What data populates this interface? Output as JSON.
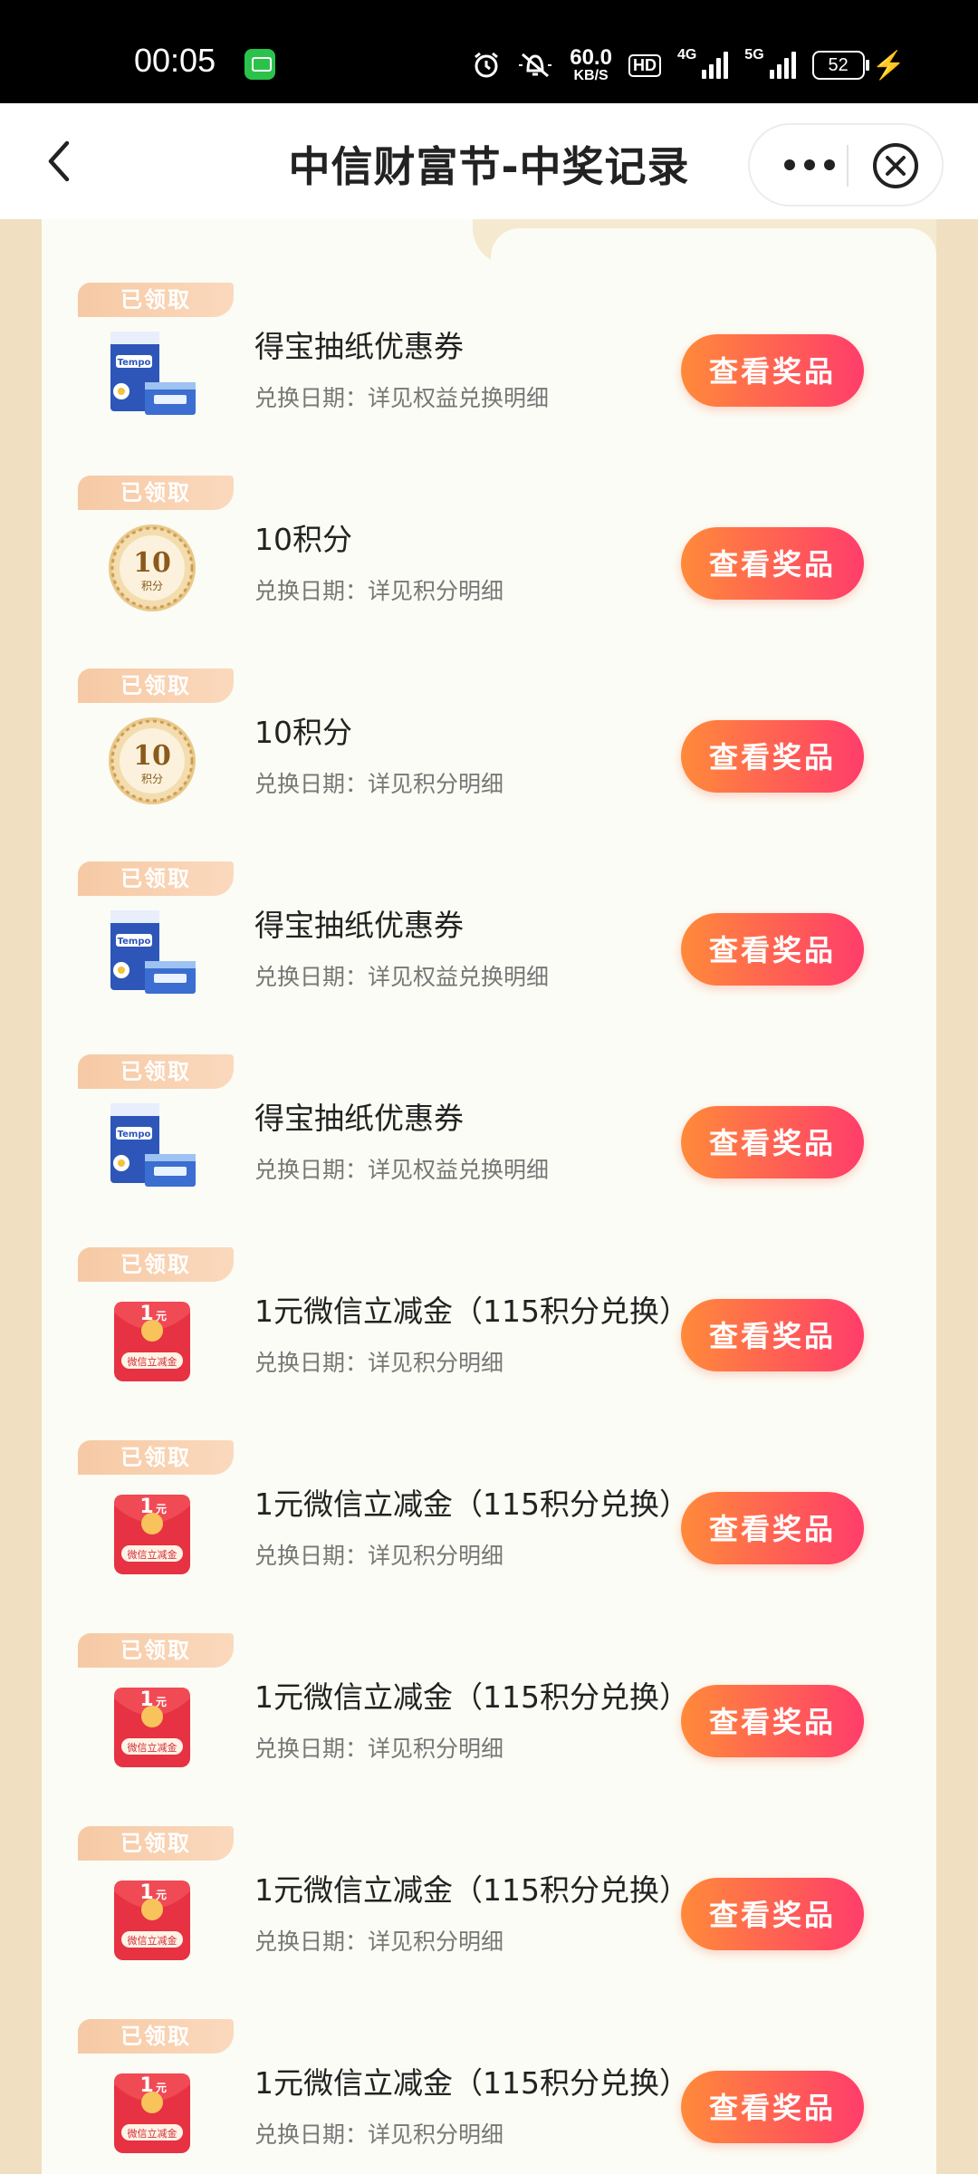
{
  "status_bar": {
    "time": "00:05",
    "speed_value": "60.0",
    "speed_unit": "KB/S",
    "hd_label": "HD",
    "net1": "4G",
    "net2": "5G",
    "battery": "52"
  },
  "header": {
    "title": "中信财富节-中奖记录"
  },
  "records": [
    {
      "tag": "已领取",
      "icon": "tissue-pack-icon",
      "title": "得宝抽纸优惠券",
      "subtitle": "兑换日期：详见权益兑换明细",
      "button": "查看奖品"
    },
    {
      "tag": "已领取",
      "icon": "points-coin-icon",
      "title": "10积分",
      "subtitle": "兑换日期：详见积分明细",
      "button": "查看奖品"
    },
    {
      "tag": "已领取",
      "icon": "points-coin-icon",
      "title": "10积分",
      "subtitle": "兑换日期：详见积分明细",
      "button": "查看奖品"
    },
    {
      "tag": "已领取",
      "icon": "tissue-pack-icon",
      "title": "得宝抽纸优惠券",
      "subtitle": "兑换日期：详见权益兑换明细",
      "button": "查看奖品"
    },
    {
      "tag": "已领取",
      "icon": "tissue-pack-icon",
      "title": "得宝抽纸优惠券",
      "subtitle": "兑换日期：详见权益兑换明细",
      "button": "查看奖品"
    },
    {
      "tag": "已领取",
      "icon": "red-envelope-icon",
      "title": "1元微信立减金（115积分兑换）",
      "subtitle": "兑换日期：详见积分明细",
      "button": "查看奖品"
    },
    {
      "tag": "已领取",
      "icon": "red-envelope-icon",
      "title": "1元微信立减金（115积分兑换）",
      "subtitle": "兑换日期：详见积分明细",
      "button": "查看奖品"
    },
    {
      "tag": "已领取",
      "icon": "red-envelope-icon",
      "title": "1元微信立减金（115积分兑换）",
      "subtitle": "兑换日期：详见积分明细",
      "button": "查看奖品"
    },
    {
      "tag": "已领取",
      "icon": "red-envelope-icon",
      "title": "1元微信立减金（115积分兑换）",
      "subtitle": "兑换日期：详见积分明细",
      "button": "查看奖品"
    },
    {
      "tag": "已领取",
      "icon": "red-envelope-icon",
      "title": "1元微信立减金（115积分兑换）",
      "subtitle": "兑换日期：详见积分明细",
      "button": "查看奖品"
    }
  ],
  "icon_text": {
    "coin_value": "10",
    "coin_unit": "积分",
    "envelope_value": "1",
    "envelope_unit": "元",
    "envelope_caption": "微信立减金",
    "tissue_brand": "Tempo"
  },
  "colors": {
    "button_start": "#ff8a3a",
    "button_end": "#ff3d6a",
    "tag": "#f6c9a4",
    "page_bg": "#f3e3c8",
    "panel_bg": "#fbfcf5"
  }
}
